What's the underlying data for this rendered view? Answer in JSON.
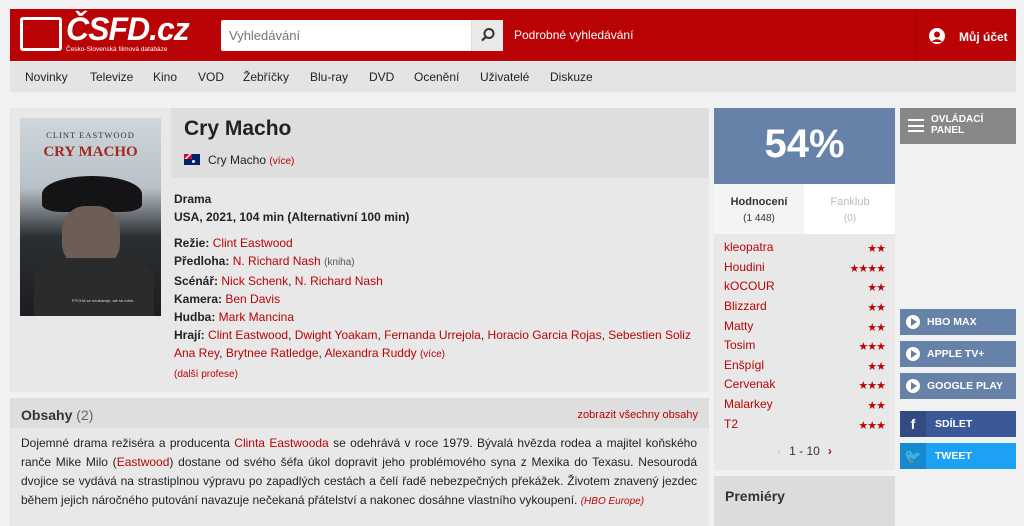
{
  "header": {
    "logo_text": "ČSFD.cz",
    "logo_sub": "Česko-Slovenská filmová databáze",
    "search_placeholder": "Vyhledávání",
    "advanced_search": "Podrobné vyhledávání",
    "account": "Můj účet"
  },
  "nav": [
    "Novinky",
    "Televize",
    "Kino",
    "VOD",
    "Žebříčky",
    "Blu-ray",
    "DVD",
    "Ocenění",
    "Uživatelé",
    "Diskuze"
  ],
  "poster": {
    "top": "CLINT EASTWOOD",
    "title": "CRY MACHO",
    "tag": "PÝCHA se neukazuje, ale se mění."
  },
  "film": {
    "title": "Cry Macho",
    "original_title": "Cry Macho",
    "more": "(více)",
    "genre": "Drama",
    "origin": "USA, 2021, 104 min (Alternativní 100 min)",
    "credits": {
      "director_label": "Režie:",
      "director": "Clint Eastwood",
      "source_label": "Předloha:",
      "source": "N. Richard Nash",
      "source_note": "(kniha)",
      "screenplay_label": "Scénář:",
      "screenplay_1": "Nick Schenk",
      "screenplay_2": "N. Richard Nash",
      "camera_label": "Kamera:",
      "camera": "Ben Davis",
      "music_label": "Hudba:",
      "music": "Mark Mancina",
      "cast_label": "Hrají:",
      "cast": [
        "Clint Eastwood",
        "Dwight Yoakam",
        "Fernanda Urrejola",
        "Horacio Garcia Rojas",
        "Sebestien Soliz",
        "Ana Rey",
        "Brytnee Ratledge",
        "Alexandra Ruddy"
      ],
      "cast_more": "(více)",
      "other": "(další profese)"
    }
  },
  "plot": {
    "title": "Obsahy",
    "count": "(2)",
    "show_all": "zobrazit všechny obsahy",
    "text_1": "Dojemné drama režiséra a producenta ",
    "link_1": "Clinta Eastwooda",
    "text_2": " se odehrává v roce 1979. Bývalá hvězda rodea a majitel koňského ranče Mike Milo (",
    "link_2": "Eastwood",
    "text_3": ") dostane od svého šéfa úkol dopravit jeho problémového syna z Mexika do Texasu. Nesourodá dvojice se vydává na strastiplnou výpravu po zapadlých cestách a čelí řadě nebezpečných překážek. Životem znavený jezdec během jejich náročného putování navazuje nečekaná přátelství a nakonec dosáhne vlastního vykoupení. ",
    "source": "(HBO Europe)"
  },
  "rating": {
    "percent": "54%",
    "tab_ratings": "Hodnocení",
    "tab_ratings_count": "(1 448)",
    "tab_fanclub": "Fanklub",
    "tab_fanclub_count": "(0)",
    "users": [
      {
        "name": "kleopatra",
        "stars": "★★",
        "value": 2
      },
      {
        "name": "Houdini",
        "stars": "★★★★",
        "value": 4
      },
      {
        "name": "kOCOUR",
        "stars": "★★",
        "value": 2
      },
      {
        "name": "Blizzard",
        "stars": "★★",
        "value": 2
      },
      {
        "name": "Matty",
        "stars": "★★",
        "value": 2
      },
      {
        "name": "Tosim",
        "stars": "★★★",
        "value": 3
      },
      {
        "name": "Enšpígl",
        "stars": "★★",
        "value": 2
      },
      {
        "name": "Cervenak",
        "stars": "★★★",
        "value": 3
      },
      {
        "name": "Malarkey",
        "stars": "★★",
        "value": 2
      },
      {
        "name": "T2",
        "stars": "★★★",
        "value": 3
      }
    ],
    "pager": "1 - 10",
    "prev": "‹",
    "next": "›"
  },
  "premieres": "Premiéry",
  "sidebar": {
    "control_panel": "OVLÁDACÍ PANEL",
    "vod": [
      "HBO MAX",
      "APPLE TV+",
      "GOOGLE PLAY"
    ],
    "share": "SDÍLET",
    "tweet": "TWEET"
  },
  "colors": {
    "brand": "#ba0305",
    "rating": "#6682a8",
    "facebook": "#3b5998",
    "twitter": "#1da1f2"
  }
}
